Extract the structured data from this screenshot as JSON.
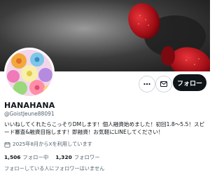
{
  "profile": {
    "display_name": "HANAHANA",
    "handle": "@GoistJeune88091",
    "bio": "いいねしてくれたらこっそりDMします！個人融資始めました！初回1.8〜5.5！スピード審査&融資目指します！即融資！お気軽にLINEしてください！",
    "joined": "2025年8月からXを利用しています"
  },
  "actions": {
    "follow_label": "フォロー"
  },
  "stats": {
    "following_count": "1,506",
    "following_label": "フォロー中",
    "followers_count": "1,320",
    "followers_label": "フォロワー"
  },
  "followed_by_text": "フォローしている人にフォロワーはいません",
  "icons": {
    "more": "more-icon",
    "mail": "mail-icon",
    "calendar": "calendar-icon"
  },
  "colors": {
    "follow_button_bg": "#0f1419",
    "secondary_text": "#536471",
    "banner_accent": "#c0121a"
  }
}
